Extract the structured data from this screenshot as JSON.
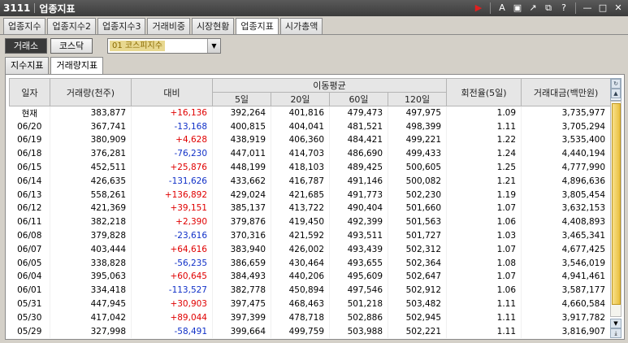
{
  "window": {
    "code": "3111",
    "title": "업종지표",
    "icons": [
      "play-icon",
      "font-icon",
      "capture-icon",
      "link-icon",
      "copy-icon",
      "help-icon",
      "minimize-icon",
      "maximize-icon",
      "close-icon"
    ]
  },
  "main_tabs": [
    "업종지수",
    "업종지수2",
    "업종지수3",
    "거래비중",
    "시장현황",
    "업종지표",
    "시가총액"
  ],
  "active_main_tab": "업종지표",
  "market": {
    "kospi_label": "거래소",
    "kosdaq_label": "코스닥",
    "selected_market": "거래소"
  },
  "sector_combo": {
    "value": "01  코스피지수"
  },
  "sub_tabs": [
    "지수지표",
    "거래량지표"
  ],
  "active_sub_tab": "거래량지표",
  "table": {
    "headers": {
      "date": "일자",
      "volume": "거래량(천주)",
      "change": "대비",
      "ma_group": "이동평균",
      "ma5": "5일",
      "ma20": "20일",
      "ma60": "60일",
      "ma120": "120일",
      "turnover": "회전율(5일)",
      "amount": "거래대금(백만원)"
    },
    "rows": [
      {
        "date": "현재",
        "volume": "383,877",
        "change": "+16,136",
        "dir": "up",
        "ma5": "392,264",
        "ma20": "401,816",
        "ma60": "479,473",
        "ma120": "497,975",
        "turnover": "1.09",
        "amount": "3,735,977"
      },
      {
        "date": "06/20",
        "volume": "367,741",
        "change": "-13,168",
        "dir": "down",
        "ma5": "400,815",
        "ma20": "404,041",
        "ma60": "481,521",
        "ma120": "498,399",
        "turnover": "1.11",
        "amount": "3,705,294"
      },
      {
        "date": "06/19",
        "volume": "380,909",
        "change": "+4,628",
        "dir": "up",
        "ma5": "438,919",
        "ma20": "406,360",
        "ma60": "484,421",
        "ma120": "499,221",
        "turnover": "1.22",
        "amount": "3,535,400"
      },
      {
        "date": "06/18",
        "volume": "376,281",
        "change": "-76,230",
        "dir": "down",
        "ma5": "447,011",
        "ma20": "414,703",
        "ma60": "486,690",
        "ma120": "499,433",
        "turnover": "1.24",
        "amount": "4,440,194"
      },
      {
        "date": "06/15",
        "volume": "452,511",
        "change": "+25,876",
        "dir": "up",
        "ma5": "448,199",
        "ma20": "418,103",
        "ma60": "489,425",
        "ma120": "500,605",
        "turnover": "1.25",
        "amount": "4,777,990"
      },
      {
        "date": "06/14",
        "volume": "426,635",
        "change": "-131,626",
        "dir": "down",
        "ma5": "433,662",
        "ma20": "416,787",
        "ma60": "491,146",
        "ma120": "500,082",
        "turnover": "1.21",
        "amount": "4,896,636"
      },
      {
        "date": "06/13",
        "volume": "558,261",
        "change": "+136,892",
        "dir": "up",
        "ma5": "429,024",
        "ma20": "421,685",
        "ma60": "491,773",
        "ma120": "502,230",
        "turnover": "1.19",
        "amount": "3,805,454"
      },
      {
        "date": "06/12",
        "volume": "421,369",
        "change": "+39,151",
        "dir": "up",
        "ma5": "385,137",
        "ma20": "413,722",
        "ma60": "490,404",
        "ma120": "501,660",
        "turnover": "1.07",
        "amount": "3,632,153"
      },
      {
        "date": "06/11",
        "volume": "382,218",
        "change": "+2,390",
        "dir": "up",
        "ma5": "379,876",
        "ma20": "419,450",
        "ma60": "492,399",
        "ma120": "501,563",
        "turnover": "1.06",
        "amount": "4,408,893"
      },
      {
        "date": "06/08",
        "volume": "379,828",
        "change": "-23,616",
        "dir": "down",
        "ma5": "370,316",
        "ma20": "421,592",
        "ma60": "493,511",
        "ma120": "501,727",
        "turnover": "1.03",
        "amount": "3,465,341"
      },
      {
        "date": "06/07",
        "volume": "403,444",
        "change": "+64,616",
        "dir": "up",
        "ma5": "383,940",
        "ma20": "426,002",
        "ma60": "493,439",
        "ma120": "502,312",
        "turnover": "1.07",
        "amount": "4,677,425"
      },
      {
        "date": "06/05",
        "volume": "338,828",
        "change": "-56,235",
        "dir": "down",
        "ma5": "386,659",
        "ma20": "430,464",
        "ma60": "493,655",
        "ma120": "502,364",
        "turnover": "1.08",
        "amount": "3,546,019"
      },
      {
        "date": "06/04",
        "volume": "395,063",
        "change": "+60,645",
        "dir": "up",
        "ma5": "384,493",
        "ma20": "440,206",
        "ma60": "495,609",
        "ma120": "502,647",
        "turnover": "1.07",
        "amount": "4,941,461"
      },
      {
        "date": "06/01",
        "volume": "334,418",
        "change": "-113,527",
        "dir": "down",
        "ma5": "382,778",
        "ma20": "450,894",
        "ma60": "497,546",
        "ma120": "502,912",
        "turnover": "1.06",
        "amount": "3,587,177"
      },
      {
        "date": "05/31",
        "volume": "447,945",
        "change": "+30,903",
        "dir": "up",
        "ma5": "397,475",
        "ma20": "468,463",
        "ma60": "501,218",
        "ma120": "503,482",
        "turnover": "1.11",
        "amount": "4,660,584"
      },
      {
        "date": "05/30",
        "volume": "417,042",
        "change": "+89,044",
        "dir": "up",
        "ma5": "397,399",
        "ma20": "478,718",
        "ma60": "502,886",
        "ma120": "502,945",
        "turnover": "1.11",
        "amount": "3,917,782"
      },
      {
        "date": "05/29",
        "volume": "327,998",
        "change": "-58,491",
        "dir": "down",
        "ma5": "399,664",
        "ma20": "499,759",
        "ma60": "503,988",
        "ma120": "502,221",
        "turnover": "1.11",
        "amount": "3,816,907"
      }
    ]
  }
}
